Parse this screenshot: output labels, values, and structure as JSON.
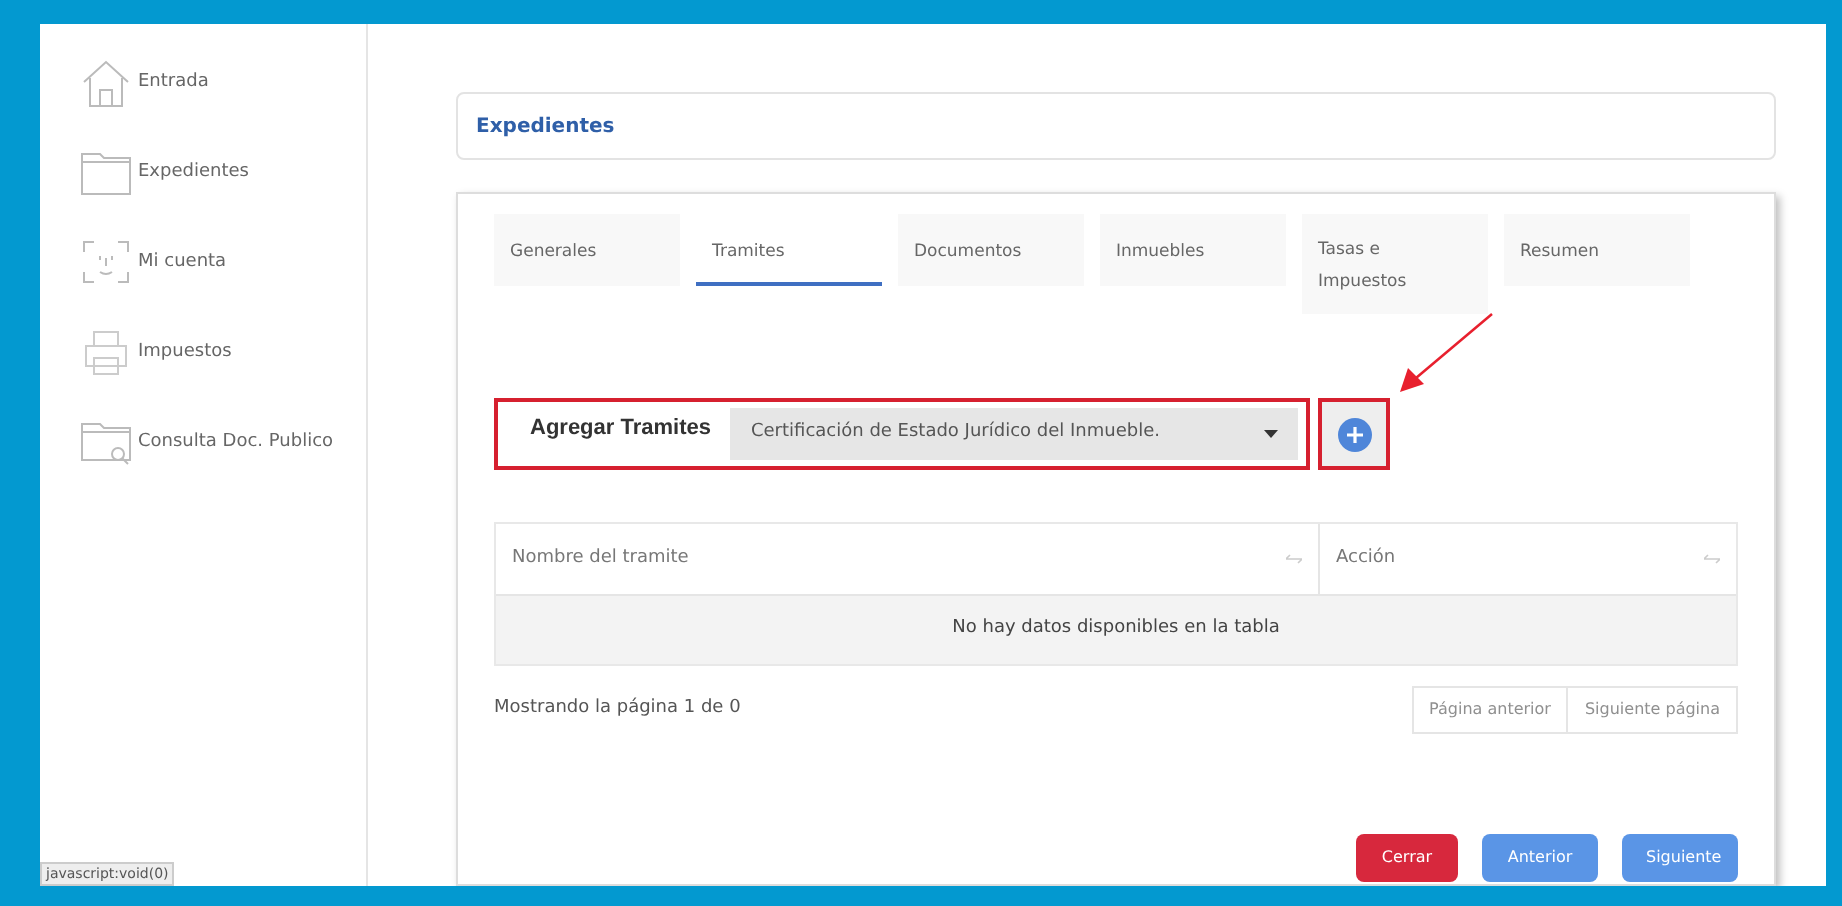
{
  "sidebar": {
    "items": [
      {
        "label": "Entrada"
      },
      {
        "label": "Expedientes"
      },
      {
        "label": "Mi cuenta"
      },
      {
        "label": "Impuestos"
      },
      {
        "label": "Consulta Doc. Publico"
      }
    ]
  },
  "breadcrumb": "Expedientes",
  "tabs": [
    {
      "label": "Generales",
      "selected": false
    },
    {
      "label": "Tramites",
      "selected": true
    },
    {
      "label": "Documentos",
      "selected": false
    },
    {
      "label": "Inmuebles",
      "selected": false
    },
    {
      "label": "Tasas e Impuestos",
      "selected": false
    },
    {
      "label": "Resumen",
      "selected": false
    }
  ],
  "add_row": {
    "label": "Agregar Tramites",
    "value": "Certificación de Estado Jurídico del Inmueble."
  },
  "table": {
    "columns": [
      "Nombre del tramite",
      "Acción"
    ],
    "empty_message": "No hay datos disponibles en la tabla"
  },
  "pagination": {
    "info": "Mostrando la página 1 de 0",
    "buttons": [
      {
        "label": "Página anterior",
        "disabled": true
      },
      {
        "label": "Siguiente página",
        "disabled": true
      }
    ]
  },
  "actions": [
    {
      "label": "Cerrar",
      "kind": "danger"
    },
    {
      "label": "Anterior",
      "kind": "primary"
    },
    {
      "label": "Siguiente",
      "kind": "primary"
    }
  ],
  "status_link": "javascript:void(0)"
}
